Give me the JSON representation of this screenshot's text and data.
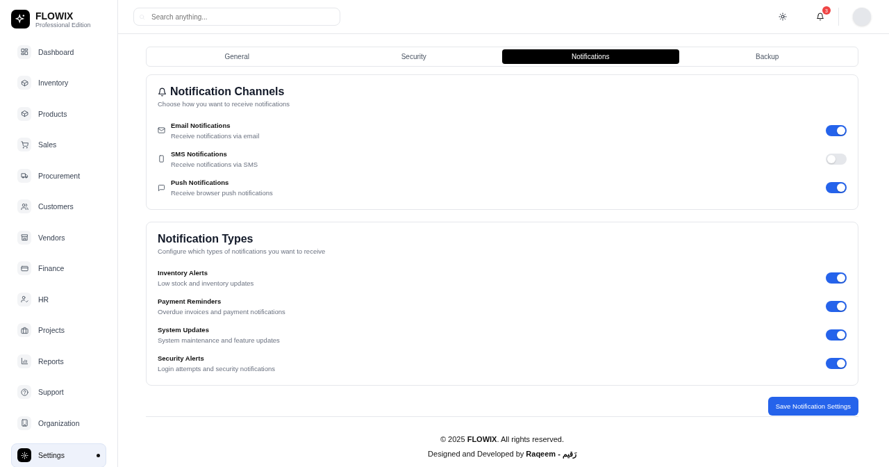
{
  "brand": {
    "name": "FLOWIX",
    "edition": "Professional Edition"
  },
  "sidebar": {
    "items": [
      {
        "label": "Dashboard",
        "selected": false
      },
      {
        "label": "Inventory",
        "selected": false
      },
      {
        "label": "Products",
        "selected": false
      },
      {
        "label": "Sales",
        "selected": false
      },
      {
        "label": "Procurement",
        "selected": false
      },
      {
        "label": "Customers",
        "selected": false
      },
      {
        "label": "Vendors",
        "selected": false
      },
      {
        "label": "Finance",
        "selected": false
      },
      {
        "label": "HR",
        "selected": false
      },
      {
        "label": "Projects",
        "selected": false
      },
      {
        "label": "Reports",
        "selected": false
      },
      {
        "label": "Support",
        "selected": false
      },
      {
        "label": "Organization",
        "selected": false
      },
      {
        "label": "Settings",
        "selected": true
      }
    ]
  },
  "header": {
    "search": {
      "placeholder": "Search anything..."
    },
    "notification_count": "3"
  },
  "tabs": [
    {
      "label": "General",
      "selected": false
    },
    {
      "label": "Security",
      "selected": false
    },
    {
      "label": "Notifications",
      "selected": true
    },
    {
      "label": "Backup",
      "selected": false
    }
  ],
  "sections": [
    {
      "title": "Notification Channels",
      "subtitle": "Choose how you want to receive notifications",
      "has_icon": true,
      "items": [
        {
          "kind": "email",
          "title": "Email Notifications",
          "description": "Receive notifications via email",
          "on": true
        },
        {
          "kind": "phone",
          "title": "SMS Notifications",
          "description": "Receive notifications via SMS",
          "on": false
        },
        {
          "kind": "chat",
          "title": "Push Notifications",
          "description": "Receive browser push notifications",
          "on": true
        }
      ]
    },
    {
      "title": "Notification Types",
      "subtitle": "Configure which types of notifications you want to receive",
      "has_icon": false,
      "items": [
        {
          "kind": "plain",
          "title": "Inventory Alerts",
          "description": "Low stock and inventory updates",
          "on": true
        },
        {
          "kind": "plain",
          "title": "Payment Reminders",
          "description": "Overdue invoices and payment notifications",
          "on": true
        },
        {
          "kind": "plain",
          "title": "System Updates",
          "description": "System maintenance and feature updates",
          "on": true
        },
        {
          "kind": "plain",
          "title": "Security Alerts",
          "description": "Login attempts and security notifications",
          "on": true
        }
      ]
    }
  ],
  "save_button": "Save Notification Settings",
  "footer": {
    "copyright": "© 2025 **FLOWIX**. All rights reserved.",
    "credit": "Designed and Developed by **Raqeem - رَقيم**"
  }
}
